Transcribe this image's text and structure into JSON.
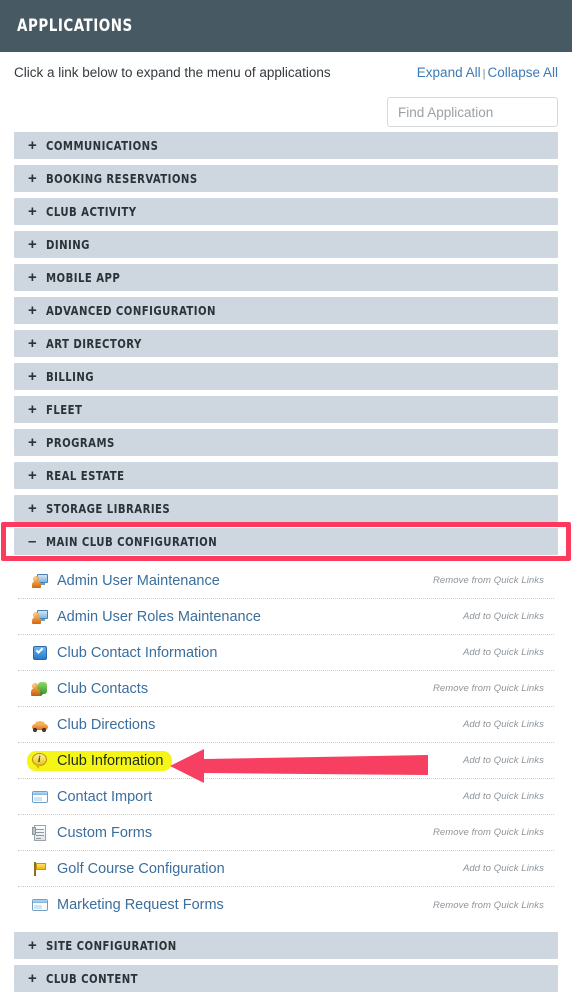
{
  "header": {
    "title": "APPLICATIONS",
    "bar_color": "#475a64"
  },
  "intro": {
    "text": "Click a link below to expand the menu of applications",
    "expand_all": "Expand All",
    "separator": "|",
    "collapse_all": "Collapse All",
    "link_color": "#3c7ab5"
  },
  "search": {
    "value": "",
    "placeholder": "Find Application"
  },
  "accordion": {
    "collapsed_sign": "+",
    "expanded_sign": "–",
    "header_color": "#ced7df",
    "sections_before": [
      {
        "label": "COMMUNICATIONS",
        "state": "collapsed"
      },
      {
        "label": "BOOKING RESERVATIONS",
        "state": "collapsed"
      },
      {
        "label": "CLUB ACTIVITY",
        "state": "collapsed"
      },
      {
        "label": "DINING",
        "state": "collapsed"
      },
      {
        "label": "MOBILE APP",
        "state": "collapsed"
      },
      {
        "label": "ADVANCED CONFIGURATION",
        "state": "collapsed"
      },
      {
        "label": "ART DIRECTORY",
        "state": "collapsed"
      },
      {
        "label": "BILLING",
        "state": "collapsed"
      },
      {
        "label": "FLEET",
        "state": "collapsed"
      },
      {
        "label": "PROGRAMS",
        "state": "collapsed"
      },
      {
        "label": "REAL ESTATE",
        "state": "collapsed"
      },
      {
        "label": "STORAGE LIBRARIES",
        "state": "collapsed"
      }
    ],
    "expanded_section": {
      "label": "MAIN CLUB CONFIGURATION",
      "state": "expanded",
      "highlight_color": "#fb3a5d",
      "items": [
        {
          "name": "Admin User Maintenance",
          "icon": "user-monitor-icon",
          "quick_link": "Remove from Quick Links",
          "highlighted": false
        },
        {
          "name": "Admin User Roles Maintenance",
          "icon": "user-monitor-icon",
          "quick_link": "Add to Quick Links",
          "highlighted": false
        },
        {
          "name": "Club Contact Information",
          "icon": "blue-check-icon",
          "quick_link": "Add to Quick Links",
          "highlighted": false
        },
        {
          "name": "Club Contacts",
          "icon": "people-group-icon",
          "quick_link": "Remove from Quick Links",
          "highlighted": false
        },
        {
          "name": "Club Directions",
          "icon": "car-icon",
          "quick_link": "Add to Quick Links",
          "highlighted": false
        },
        {
          "name": "Club Information",
          "icon": "info-bubble-icon",
          "quick_link": "Add to Quick Links",
          "highlighted": true
        },
        {
          "name": "Contact Import",
          "icon": "window-icon",
          "quick_link": "Add to Quick Links",
          "highlighted": false
        },
        {
          "name": "Custom Forms",
          "icon": "document-icon",
          "quick_link": "Remove from Quick Links",
          "highlighted": false
        },
        {
          "name": "Golf Course Configuration",
          "icon": "flag-icon",
          "quick_link": "Add to Quick Links",
          "highlighted": false
        },
        {
          "name": "Marketing Request Forms",
          "icon": "window-icon",
          "quick_link": "Remove from Quick Links",
          "highlighted": false
        }
      ]
    },
    "sections_after": [
      {
        "label": "SITE CONFIGURATION",
        "state": "collapsed"
      },
      {
        "label": "CLUB CONTENT",
        "state": "collapsed"
      }
    ]
  },
  "annotation": {
    "arrow_color": "#f73f62",
    "arrow_points_to": "Club Information",
    "highlight_color": "#f6f518"
  }
}
